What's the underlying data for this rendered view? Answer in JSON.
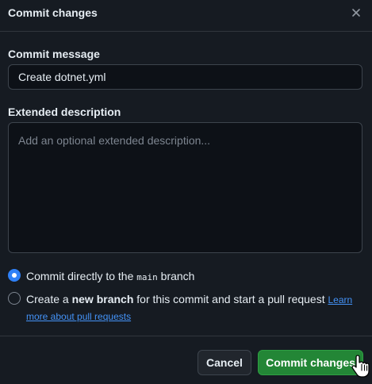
{
  "dialog": {
    "title": "Commit changes",
    "close_icon": "close-icon"
  },
  "commit_message": {
    "label": "Commit message",
    "value": "Create dotnet.yml"
  },
  "extended_description": {
    "label": "Extended description",
    "placeholder": "Add an optional extended description..."
  },
  "options": {
    "direct": {
      "prefix": "Commit directly to the ",
      "branch": "main",
      "suffix": " branch",
      "checked": true
    },
    "new_branch": {
      "prefix": "Create a ",
      "bold": "new branch",
      "suffix": " for this commit and start a pull request ",
      "link": "Learn more about pull requests",
      "checked": false
    }
  },
  "footer": {
    "cancel_label": "Cancel",
    "commit_label": "Commit changes"
  },
  "colors": {
    "background": "#161b22",
    "accent": "#2f81f7",
    "primary_button": "#238636",
    "link": "#4493f8"
  }
}
